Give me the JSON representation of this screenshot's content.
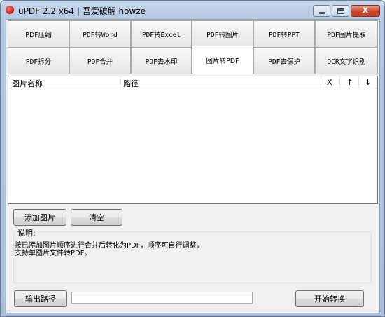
{
  "window": {
    "title": "uPDF 2.2 x64 | 吾爱破解 howze",
    "icons": {
      "app": "app-logo-icon",
      "minimize": "minimize-icon",
      "maximize": "maximize-icon",
      "close": "close-icon",
      "close_glyph": "x"
    }
  },
  "tabs": [
    {
      "label": "PDF压缩"
    },
    {
      "label": "PDF转Word"
    },
    {
      "label": "PDF转Excel"
    },
    {
      "label": "PDF转图片"
    },
    {
      "label": "PDF转PPT"
    },
    {
      "label": "PDF图片提取"
    },
    {
      "label": "PDF拆分"
    },
    {
      "label": "PDF合并"
    },
    {
      "label": "PDF去水印"
    },
    {
      "label": "图片转PDF",
      "active": true
    },
    {
      "label": "PDF去保护"
    },
    {
      "label": "OCR文字识别"
    }
  ],
  "list": {
    "columns": [
      "图片名称",
      "路径",
      "X",
      "↑",
      "↓"
    ],
    "rows": []
  },
  "buttons": {
    "add_image": "添加图片",
    "clear": "清空",
    "output_path": "输出路径",
    "start": "开始转换"
  },
  "description": {
    "label": "说明:",
    "lines": [
      "按已添加图片顺序进行合并后转化为PDF，顺序可自行调整。",
      "支持单图片文件转PDF。"
    ]
  },
  "output": {
    "path_value": ""
  }
}
